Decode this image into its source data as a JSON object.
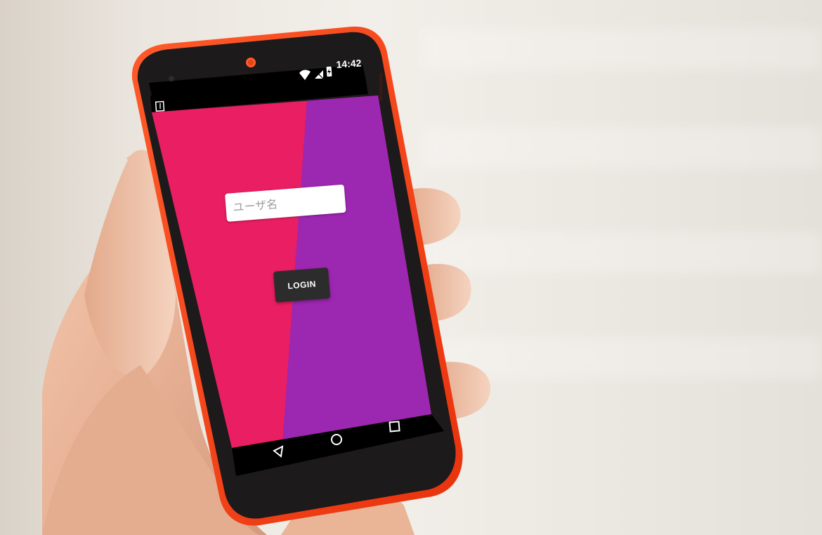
{
  "login_screen": {
    "status_bar": {
      "time": "14:42",
      "icons": [
        "wifi-icon",
        "signal-icon",
        "battery-charging-icon"
      ],
      "notification_icon": "download-notification-icon"
    },
    "username_field": {
      "placeholder": "ユーザ名",
      "value": ""
    },
    "login_button": {
      "label": "LOGIN"
    },
    "nav_bar": {
      "back": "back-icon",
      "home": "home-icon",
      "recents": "recents-icon"
    },
    "colors": {
      "background_left": "#e91e63",
      "background_right": "#9c27b0",
      "button": "#2c2c2c",
      "phone_bezel": "#ff3d1a"
    }
  }
}
